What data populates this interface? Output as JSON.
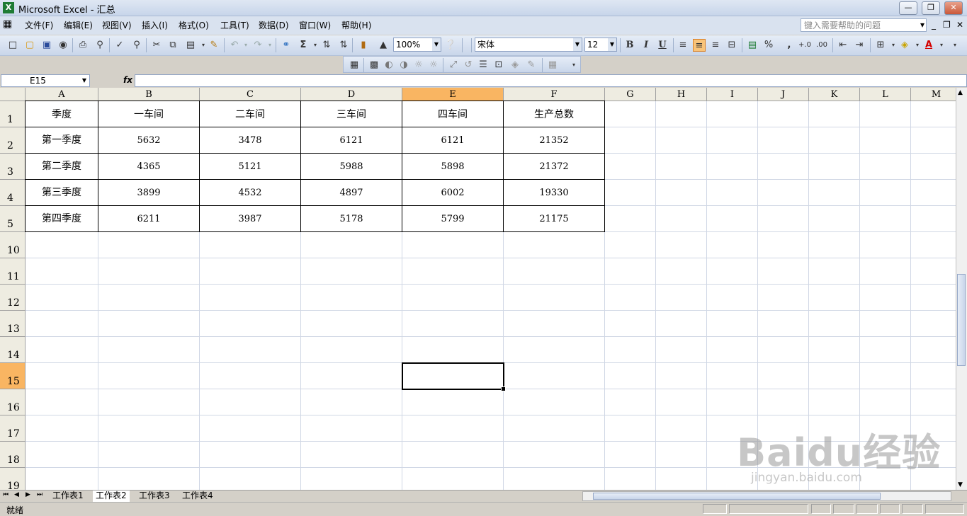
{
  "window": {
    "title": "Microsoft Excel - 汇总",
    "app_icon": "excel-icon"
  },
  "menu": {
    "items": [
      "文件(F)",
      "编辑(E)",
      "视图(V)",
      "插入(I)",
      "格式(O)",
      "工具(T)",
      "数据(D)",
      "窗口(W)",
      "帮助(H)"
    ],
    "help_placeholder": "键入需要帮助的问题"
  },
  "toolbar": {
    "zoom": "100%",
    "font_name": "宋体",
    "font_size": "12",
    "bold": "B",
    "italic": "I",
    "underline": "U",
    "percent": "%",
    "comma": ","
  },
  "formula_bar": {
    "name_box": "E15",
    "fx": "fx",
    "content": ""
  },
  "columns": [
    "A",
    "B",
    "C",
    "D",
    "E",
    "F",
    "G",
    "H",
    "I",
    "J",
    "K",
    "L",
    "M"
  ],
  "selected_column": "E",
  "rows": [
    "1",
    "2",
    "3",
    "4",
    "5",
    "10",
    "11",
    "12",
    "13",
    "14",
    "15",
    "16",
    "17",
    "18",
    "19"
  ],
  "selected_row": "15",
  "table": {
    "header": [
      "季度",
      "一车间",
      "二车间",
      "三车间",
      "四车间",
      "生产总数"
    ],
    "rows": [
      [
        "第一季度",
        "5632",
        "3478",
        "6121",
        "6121",
        "21352"
      ],
      [
        "第二季度",
        "4365",
        "5121",
        "5988",
        "5898",
        "21372"
      ],
      [
        "第三季度",
        "3899",
        "4532",
        "4897",
        "6002",
        "19330"
      ],
      [
        "第四季度",
        "6211",
        "3987",
        "5178",
        "5799",
        "21175"
      ]
    ]
  },
  "sheet_tabs": [
    "工作表1",
    "工作表2",
    "工作表3",
    "工作表4"
  ],
  "active_sheet": "工作表2",
  "status": {
    "text": "就绪"
  },
  "watermark": {
    "logo": "Baidu经验",
    "url": "jingyan.baidu.com"
  },
  "colors": {
    "selected_header": "#f9b562",
    "gridline": "#d0d7e5",
    "comment_marker": "#d40000"
  }
}
